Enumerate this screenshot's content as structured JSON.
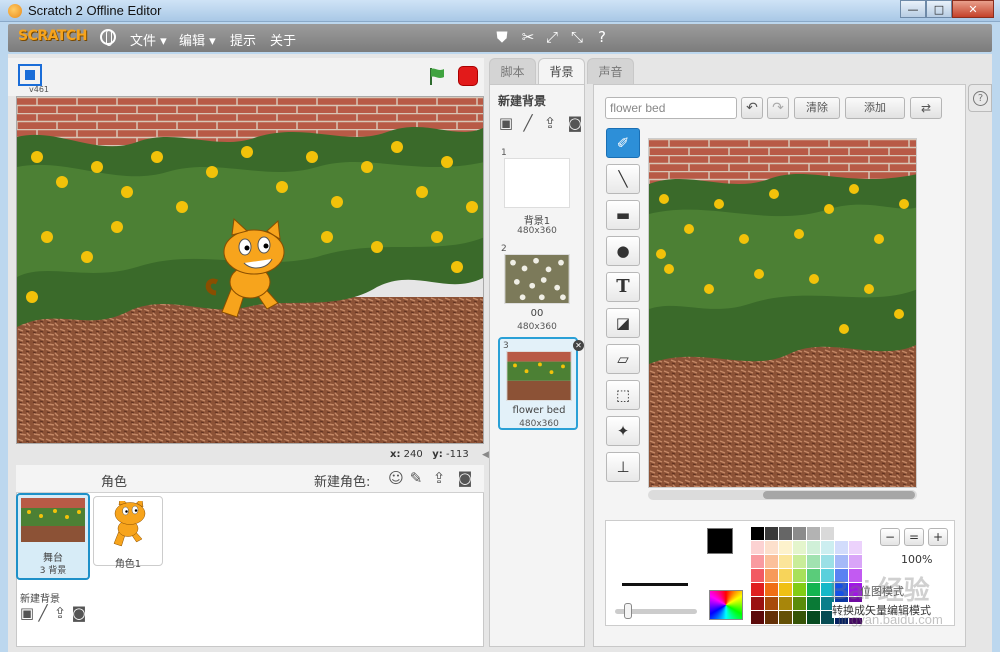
{
  "window": {
    "title": "Scratch 2 Offline Editor",
    "minimize": "—",
    "maximize": "□",
    "close": "✕"
  },
  "menubar": {
    "logo": "SCRATCH",
    "items": [
      "文件 ▾",
      "编辑 ▾",
      "提示",
      "关于"
    ],
    "tool_icons": [
      "duplicate-stamp-icon",
      "cut-scissors-icon",
      "grow-icon",
      "shrink-icon",
      "help-icon"
    ]
  },
  "stage": {
    "version": "v461",
    "x_label": "x:",
    "x_value": "240",
    "y_label": "y:",
    "y_value": "-113"
  },
  "sprites": {
    "title": "角色",
    "new_sprite_label": "新建角色:",
    "stage_thumb": {
      "label": "舞台",
      "sublabel": "3 背景"
    },
    "new_backdrop_label": "新建背景",
    "items": [
      {
        "name": "角色1"
      }
    ]
  },
  "tabs": [
    "脚本",
    "背景",
    "声音"
  ],
  "backdrops": {
    "title": "新建背景",
    "items": [
      {
        "num": "1",
        "name": "背景1",
        "size": "480x360"
      },
      {
        "num": "2",
        "name": "00",
        "size": "480x360"
      },
      {
        "num": "3",
        "name": "flower bed",
        "size": "480x360"
      }
    ]
  },
  "paint_editor": {
    "name_value": "flower bed",
    "undo": "↶",
    "redo": "↷",
    "clear_label": "清除",
    "add_label": "添加",
    "tools": [
      "brush-icon",
      "line-icon",
      "rectangle-icon",
      "ellipse-icon",
      "text-icon",
      "fill-icon",
      "eraser-icon",
      "select-icon",
      "magic-wand-icon",
      "stamp-icon"
    ],
    "text_tool": "T",
    "zoom_level": "100%",
    "zoom_out": "−",
    "zoom_reset": "=",
    "zoom_in": "+",
    "mode_label": "位图模式",
    "convert_label": "转换成矢量编辑模式",
    "colors": {
      "primary": "#000000",
      "secondary": "#ffffff",
      "palette": [
        "#000000",
        "#3a3a3a",
        "#666666",
        "#8c8c8c",
        "#b3b3b3",
        "#d9d9d9",
        "#ffffff",
        "#ffffff",
        "#fcd2d2",
        "#fde0cc",
        "#fdf2cc",
        "#e4f5cc",
        "#d0f0d8",
        "#cceef0",
        "#d2dcfc",
        "#ecd2fc",
        "#f99aa0",
        "#fbc09a",
        "#fbe59a",
        "#c9ed99",
        "#a1e2b0",
        "#9be0e6",
        "#a5b9f8",
        "#d9a5f8",
        "#f25a62",
        "#f79a5a",
        "#f7d45a",
        "#a8e05a",
        "#5acc7a",
        "#5ad0dc",
        "#5a82f2",
        "#c25af2",
        "#e01e1e",
        "#f06e14",
        "#f0c014",
        "#82cc14",
        "#14b450",
        "#14b8c8",
        "#1450e6",
        "#a014e6",
        "#9a1010",
        "#a84a0a",
        "#a8860a",
        "#5a8c0a",
        "#0a7a36",
        "#0a7e8a",
        "#0a36a0",
        "#6e0aa0",
        "#5c0a0a",
        "#643006",
        "#645006",
        "#365406",
        "#064a20",
        "#064c54",
        "#062060",
        "#420660"
      ]
    }
  },
  "watermark": {
    "text": "Bai 经验",
    "url": "jingyan.baidu.com"
  }
}
